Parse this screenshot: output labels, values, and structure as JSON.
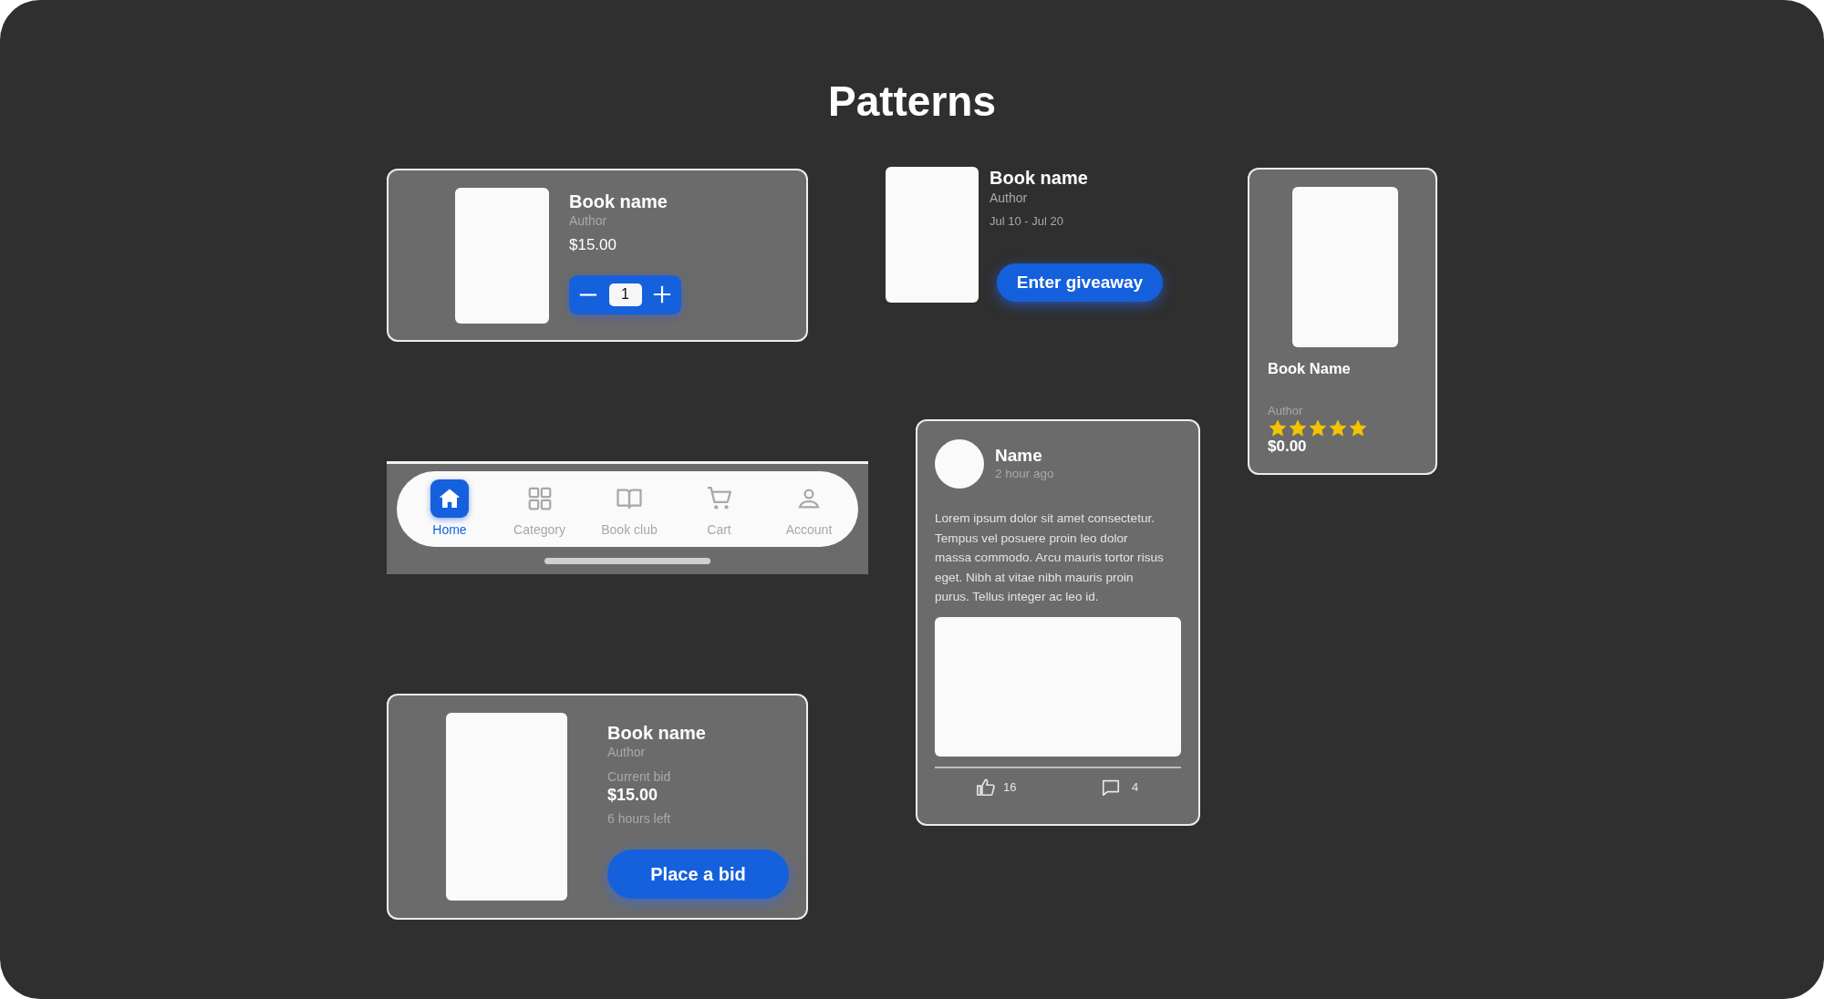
{
  "title": "Patterns",
  "cart_item": {
    "book_name": "Book name",
    "author": "Author",
    "price": "$15.00",
    "quantity": "1"
  },
  "giveaway": {
    "book_name": "Book name",
    "author": "Author",
    "dates": "Jul 10 - Jul 20",
    "button": "Enter giveaway"
  },
  "product_card": {
    "book_name": "Book Name",
    "author": "Author",
    "stars": 5,
    "price": "$0.00"
  },
  "bottom_nav": {
    "items": [
      {
        "label": "Home",
        "selected": true
      },
      {
        "label": "Category",
        "selected": false
      },
      {
        "label": "Book club",
        "selected": false
      },
      {
        "label": "Cart",
        "selected": false
      },
      {
        "label": "Account",
        "selected": false
      }
    ]
  },
  "post": {
    "name": "Name",
    "time": "2 hour ago",
    "text": "Lorem ipsum dolor sit amet consectetur. Tempus vel posuere proin leo dolor massa commodo. Arcu mauris tortor risus eget. Nibh at vitae nibh mauris proin purus. Tellus integer ac leo id.",
    "likes": "16",
    "comments": "4"
  },
  "auction": {
    "book_name": "Book name",
    "author": "Author",
    "bid_label": "Current bid",
    "bid": "$15.00",
    "time_left": "6 hours left",
    "button": "Place a bid"
  }
}
